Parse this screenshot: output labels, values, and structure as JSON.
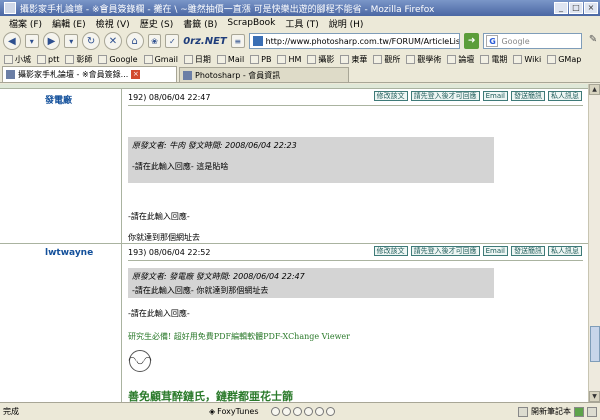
{
  "window": {
    "title": "攝影家手札論壇 - ※會員簽錄欄 - 攤在 \\ ~雖然抽價一直漲 可是快樂出遊的腳程不能省 - Mozilla Firefox",
    "controls": [
      "_",
      "□",
      "×"
    ]
  },
  "menu": [
    "檔案 (F)",
    "編輯 (E)",
    "檢視 (V)",
    "歷史 (S)",
    "書籤 (B)",
    "ScrapBook",
    "工具 (T)",
    "說明 (H)"
  ],
  "toolbar": {
    "brand": "0rz.NET",
    "url": "http://www.photosharp.com.tw/FORUM/ArticleList.",
    "search_placeholder": "Google"
  },
  "bookmarks": [
    "小城",
    "ptt",
    "彰師",
    "Google",
    "Gmail",
    "日期",
    "Mail",
    "PB",
    "HM",
    "攝影",
    "東華",
    "觀所",
    "觀學術",
    "論壇",
    "電期",
    "Wiki",
    "GMap"
  ],
  "tabs": [
    {
      "label": "攝影家手札論壇 - ※會員簽錄...",
      "active": true
    },
    {
      "label": "Photosharp - 會員資訊",
      "active": false
    }
  ],
  "action_buttons": [
    "修改該文",
    "請先登入後才可回應",
    "Email",
    "發送簡訊",
    "私人訊息"
  ],
  "posts": [
    {
      "author": "發電廠",
      "number": "192) 08/06/04 22:47",
      "quote_header": "原發文者: 牛肉 發文時間: 2008/06/04 22:23",
      "quote_body": "-請在此輸入回應- 這是貼啥",
      "reply": "-請在此輸入回應-",
      "footer": "你就達到那個網址去"
    },
    {
      "author": "lwtwayne",
      "number": "193) 08/06/04 22:52",
      "quote_header": "原發文者: 發電廠 發文時間: 2008/06/04 22:47",
      "quote_body": "-請在此輸入回應- 你就達到那個網址去",
      "reply": "-請在此輸入回應-",
      "signature_link": "研究生必備! 超好用免費PDF編輯軟體PDF-XChange Viewer",
      "signature_title": "善免顧茸醉鏈氏，鏈群都亜花士篩"
    }
  ],
  "status": {
    "text": "完成",
    "foxytunes": "FoxyTunes",
    "tray": "開新筆記本"
  }
}
